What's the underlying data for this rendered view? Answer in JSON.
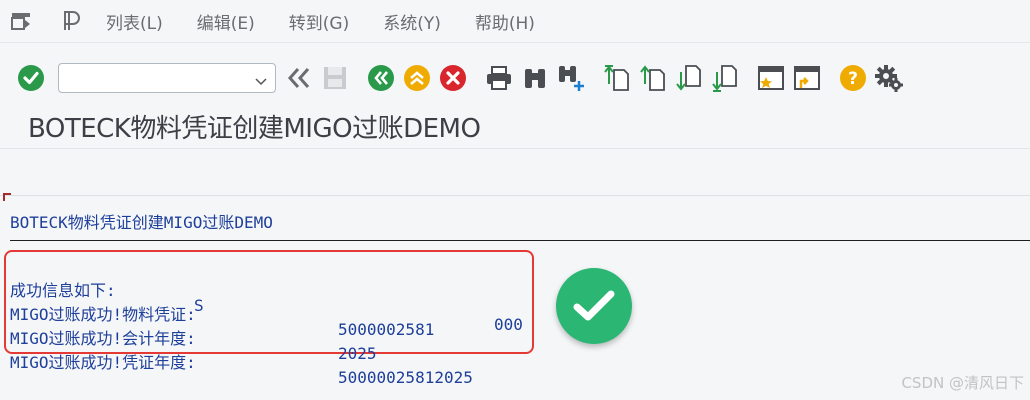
{
  "menubar": {
    "items": [
      "列表(L)",
      "编辑(E)",
      "转到(G)",
      "系统(Y)",
      "帮助(H)"
    ]
  },
  "toolbar": {
    "command_value": "",
    "icons": {
      "enter": "check-circle-icon",
      "back_fast": "double-chevron-left-icon",
      "save": "save-icon",
      "back": "back-green-icon",
      "exit": "exit-up-icon",
      "cancel": "cancel-red-icon",
      "print": "print-icon",
      "find": "binoculars-icon",
      "find_next": "binoculars-plus-icon",
      "first_page": "first-page-icon",
      "prev_page": "prev-page-icon",
      "next_page": "next-page-icon",
      "last_page": "last-page-icon",
      "create_session": "create-session-icon",
      "generate_shortcut": "shortcut-icon",
      "help": "help-icon",
      "settings": "gear-icon"
    }
  },
  "page": {
    "title": "BOTECK物料凭证创建MIGO过账DEMO"
  },
  "report": {
    "heading": "BOTECK物料凭证创建MIGO过账DEMO",
    "rows": [
      {
        "label": "成功信息如下:",
        "mid": "S",
        "value": "000"
      },
      {
        "label": "MIGO过账成功!物料凭证:",
        "value": "5000002581"
      },
      {
        "label": "MIGO过账成功!会计年度:",
        "value": "2025"
      },
      {
        "label": "MIGO过账成功!凭证年度:",
        "value": "50000025812025"
      }
    ]
  },
  "watermark": "CSDN @清风日下",
  "colors": {
    "success_green": "#2bb673",
    "box_red": "#e53935",
    "list_blue": "#1e3f9a"
  }
}
